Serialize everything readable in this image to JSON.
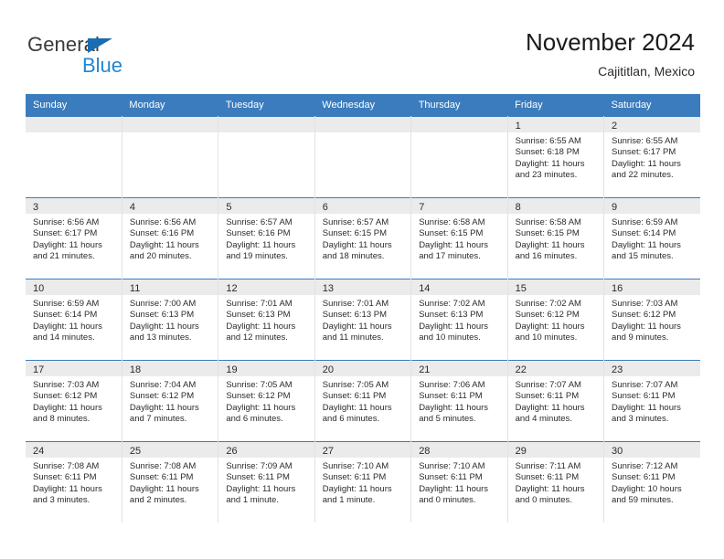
{
  "logo": {
    "word_one": "General",
    "word_two": "Blue",
    "triangle_icon": "triangle-icon",
    "accent_color": "#1b6cb0",
    "blue_text_color": "#2286d3"
  },
  "header": {
    "title": "November 2024",
    "subtitle": "Cajititlan, Mexico"
  },
  "theme": {
    "header_blue": "#3a7cbd",
    "daynum_band": "#ebebeb",
    "cell_border": "#e2e2e2"
  },
  "calendar": {
    "weekday_headers": [
      "Sunday",
      "Monday",
      "Tuesday",
      "Wednesday",
      "Thursday",
      "Friday",
      "Saturday"
    ],
    "weeks": [
      [
        {
          "day": "",
          "empty": true
        },
        {
          "day": "",
          "empty": true
        },
        {
          "day": "",
          "empty": true
        },
        {
          "day": "",
          "empty": true
        },
        {
          "day": "",
          "empty": true
        },
        {
          "day": "1",
          "sunrise": "Sunrise: 6:55 AM",
          "sunset": "Sunset: 6:18 PM",
          "daylight_1": "Daylight: 11 hours",
          "daylight_2": "and 23 minutes."
        },
        {
          "day": "2",
          "sunrise": "Sunrise: 6:55 AM",
          "sunset": "Sunset: 6:17 PM",
          "daylight_1": "Daylight: 11 hours",
          "daylight_2": "and 22 minutes."
        }
      ],
      [
        {
          "day": "3",
          "sunrise": "Sunrise: 6:56 AM",
          "sunset": "Sunset: 6:17 PM",
          "daylight_1": "Daylight: 11 hours",
          "daylight_2": "and 21 minutes."
        },
        {
          "day": "4",
          "sunrise": "Sunrise: 6:56 AM",
          "sunset": "Sunset: 6:16 PM",
          "daylight_1": "Daylight: 11 hours",
          "daylight_2": "and 20 minutes."
        },
        {
          "day": "5",
          "sunrise": "Sunrise: 6:57 AM",
          "sunset": "Sunset: 6:16 PM",
          "daylight_1": "Daylight: 11 hours",
          "daylight_2": "and 19 minutes."
        },
        {
          "day": "6",
          "sunrise": "Sunrise: 6:57 AM",
          "sunset": "Sunset: 6:15 PM",
          "daylight_1": "Daylight: 11 hours",
          "daylight_2": "and 18 minutes."
        },
        {
          "day": "7",
          "sunrise": "Sunrise: 6:58 AM",
          "sunset": "Sunset: 6:15 PM",
          "daylight_1": "Daylight: 11 hours",
          "daylight_2": "and 17 minutes."
        },
        {
          "day": "8",
          "sunrise": "Sunrise: 6:58 AM",
          "sunset": "Sunset: 6:15 PM",
          "daylight_1": "Daylight: 11 hours",
          "daylight_2": "and 16 minutes."
        },
        {
          "day": "9",
          "sunrise": "Sunrise: 6:59 AM",
          "sunset": "Sunset: 6:14 PM",
          "daylight_1": "Daylight: 11 hours",
          "daylight_2": "and 15 minutes."
        }
      ],
      [
        {
          "day": "10",
          "sunrise": "Sunrise: 6:59 AM",
          "sunset": "Sunset: 6:14 PM",
          "daylight_1": "Daylight: 11 hours",
          "daylight_2": "and 14 minutes."
        },
        {
          "day": "11",
          "sunrise": "Sunrise: 7:00 AM",
          "sunset": "Sunset: 6:13 PM",
          "daylight_1": "Daylight: 11 hours",
          "daylight_2": "and 13 minutes."
        },
        {
          "day": "12",
          "sunrise": "Sunrise: 7:01 AM",
          "sunset": "Sunset: 6:13 PM",
          "daylight_1": "Daylight: 11 hours",
          "daylight_2": "and 12 minutes."
        },
        {
          "day": "13",
          "sunrise": "Sunrise: 7:01 AM",
          "sunset": "Sunset: 6:13 PM",
          "daylight_1": "Daylight: 11 hours",
          "daylight_2": "and 11 minutes."
        },
        {
          "day": "14",
          "sunrise": "Sunrise: 7:02 AM",
          "sunset": "Sunset: 6:13 PM",
          "daylight_1": "Daylight: 11 hours",
          "daylight_2": "and 10 minutes."
        },
        {
          "day": "15",
          "sunrise": "Sunrise: 7:02 AM",
          "sunset": "Sunset: 6:12 PM",
          "daylight_1": "Daylight: 11 hours",
          "daylight_2": "and 10 minutes."
        },
        {
          "day": "16",
          "sunrise": "Sunrise: 7:03 AM",
          "sunset": "Sunset: 6:12 PM",
          "daylight_1": "Daylight: 11 hours",
          "daylight_2": "and 9 minutes."
        }
      ],
      [
        {
          "day": "17",
          "sunrise": "Sunrise: 7:03 AM",
          "sunset": "Sunset: 6:12 PM",
          "daylight_1": "Daylight: 11 hours",
          "daylight_2": "and 8 minutes."
        },
        {
          "day": "18",
          "sunrise": "Sunrise: 7:04 AM",
          "sunset": "Sunset: 6:12 PM",
          "daylight_1": "Daylight: 11 hours",
          "daylight_2": "and 7 minutes."
        },
        {
          "day": "19",
          "sunrise": "Sunrise: 7:05 AM",
          "sunset": "Sunset: 6:12 PM",
          "daylight_1": "Daylight: 11 hours",
          "daylight_2": "and 6 minutes."
        },
        {
          "day": "20",
          "sunrise": "Sunrise: 7:05 AM",
          "sunset": "Sunset: 6:11 PM",
          "daylight_1": "Daylight: 11 hours",
          "daylight_2": "and 6 minutes."
        },
        {
          "day": "21",
          "sunrise": "Sunrise: 7:06 AM",
          "sunset": "Sunset: 6:11 PM",
          "daylight_1": "Daylight: 11 hours",
          "daylight_2": "and 5 minutes."
        },
        {
          "day": "22",
          "sunrise": "Sunrise: 7:07 AM",
          "sunset": "Sunset: 6:11 PM",
          "daylight_1": "Daylight: 11 hours",
          "daylight_2": "and 4 minutes."
        },
        {
          "day": "23",
          "sunrise": "Sunrise: 7:07 AM",
          "sunset": "Sunset: 6:11 PM",
          "daylight_1": "Daylight: 11 hours",
          "daylight_2": "and 3 minutes."
        }
      ],
      [
        {
          "day": "24",
          "sunrise": "Sunrise: 7:08 AM",
          "sunset": "Sunset: 6:11 PM",
          "daylight_1": "Daylight: 11 hours",
          "daylight_2": "and 3 minutes."
        },
        {
          "day": "25",
          "sunrise": "Sunrise: 7:08 AM",
          "sunset": "Sunset: 6:11 PM",
          "daylight_1": "Daylight: 11 hours",
          "daylight_2": "and 2 minutes."
        },
        {
          "day": "26",
          "sunrise": "Sunrise: 7:09 AM",
          "sunset": "Sunset: 6:11 PM",
          "daylight_1": "Daylight: 11 hours",
          "daylight_2": "and 1 minute."
        },
        {
          "day": "27",
          "sunrise": "Sunrise: 7:10 AM",
          "sunset": "Sunset: 6:11 PM",
          "daylight_1": "Daylight: 11 hours",
          "daylight_2": "and 1 minute."
        },
        {
          "day": "28",
          "sunrise": "Sunrise: 7:10 AM",
          "sunset": "Sunset: 6:11 PM",
          "daylight_1": "Daylight: 11 hours",
          "daylight_2": "and 0 minutes."
        },
        {
          "day": "29",
          "sunrise": "Sunrise: 7:11 AM",
          "sunset": "Sunset: 6:11 PM",
          "daylight_1": "Daylight: 11 hours",
          "daylight_2": "and 0 minutes."
        },
        {
          "day": "30",
          "sunrise": "Sunrise: 7:12 AM",
          "sunset": "Sunset: 6:11 PM",
          "daylight_1": "Daylight: 10 hours",
          "daylight_2": "and 59 minutes."
        }
      ]
    ]
  }
}
